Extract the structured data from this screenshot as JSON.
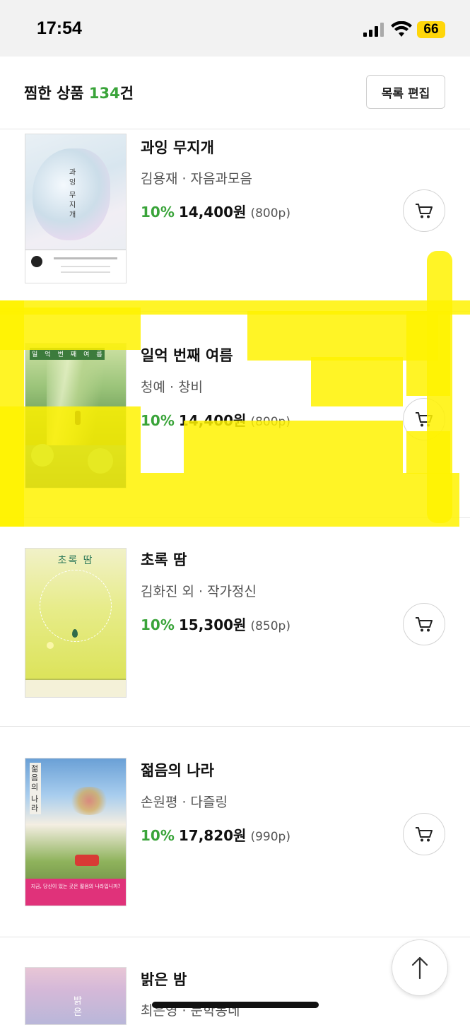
{
  "status_bar": {
    "time": "17:54",
    "battery": "66"
  },
  "header": {
    "title": "찜한 상품",
    "count": "134",
    "count_suffix": "건",
    "edit_label": "목록 편집"
  },
  "items": [
    {
      "title": "과잉 무지개",
      "meta": "김용재 · 자음과모음",
      "discount": "10%",
      "price": "14,400원",
      "point": "(800p)",
      "cover_text": [
        "과",
        "잉",
        "무",
        "지",
        "개"
      ]
    },
    {
      "title": "일억 번째 여름",
      "meta": "청예 · 창비",
      "discount": "10%",
      "price": "14,400원",
      "point": "(800p)",
      "cover_text": [
        "일",
        "억",
        "번",
        "째",
        "여",
        "름"
      ]
    },
    {
      "title": "초록 땀",
      "meta": "김화진 외 · 작가정신",
      "discount": "10%",
      "price": "15,300원",
      "point": "(850p)",
      "cover_text": "초록 땀"
    },
    {
      "title": "젊음의 나라",
      "meta": "손원평 · 다즐링",
      "discount": "10%",
      "price": "17,820원",
      "point": "(990p)",
      "cover_text": [
        "젊",
        "음",
        "의",
        "나",
        "라"
      ],
      "cover_banner": "지금, 당신이 있는 곳은 젊음의 나라입니까?"
    },
    {
      "title": "밝은 밤",
      "meta": "최은영 · 문학동네",
      "discount": "",
      "price": "",
      "point": "",
      "cover_text": [
        "밝",
        "은"
      ]
    }
  ],
  "colors": {
    "accent_green": "#3aa43a",
    "highlight": "#fff200"
  }
}
